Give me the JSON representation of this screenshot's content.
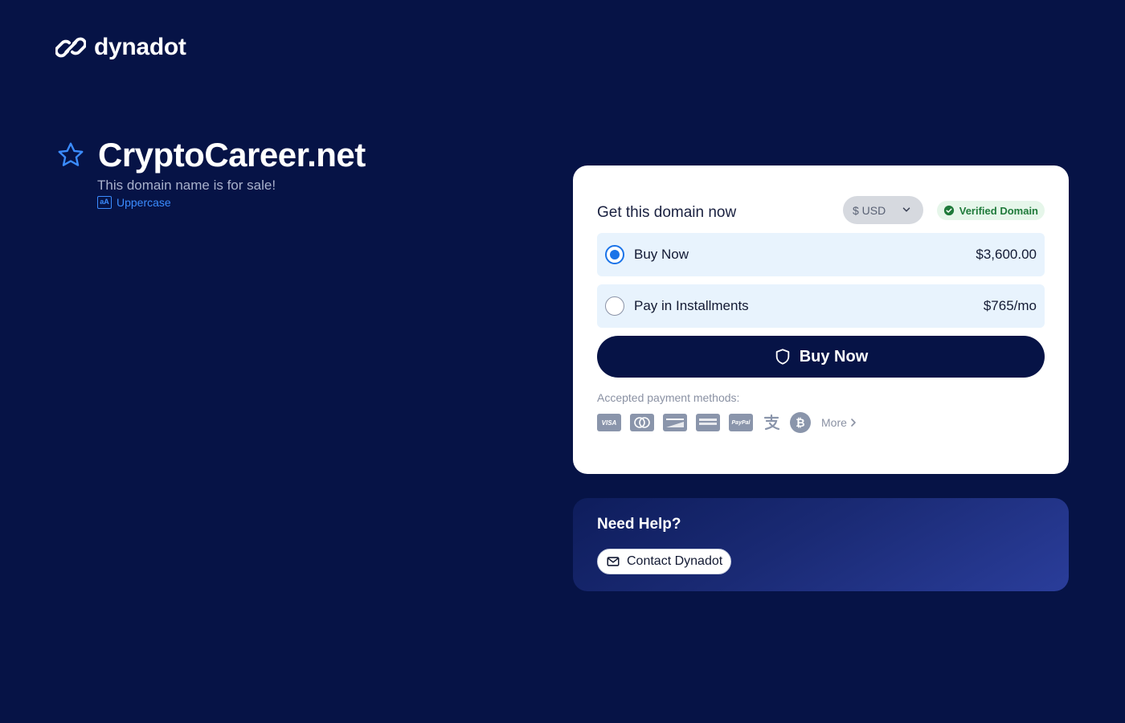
{
  "brand": {
    "name": "dynadot",
    "icon": "link-chain-icon"
  },
  "domain": {
    "name": "CryptoCareer.net",
    "subtitle": "This domain name is for sale!",
    "case_toggle_label": "Uppercase",
    "case_icon_text": "aA"
  },
  "purchase": {
    "title": "Get this domain now",
    "currency": "$ USD",
    "verified_label": "Verified Domain",
    "options": [
      {
        "label": "Buy Now",
        "price": "$3,600.00",
        "selected": true
      },
      {
        "label": "Pay in Installments",
        "price": "$765/mo",
        "selected": false
      }
    ],
    "buy_button_label": "Buy Now",
    "payment_label": "Accepted payment methods:",
    "payment_methods": [
      "VISA",
      "Mastercard",
      "DISCOVER",
      "American Express",
      "PayPal",
      "Alipay",
      "Bitcoin"
    ],
    "more_label": "More"
  },
  "help": {
    "title": "Need Help?",
    "contact_label": "Contact Dynadot"
  },
  "colors": {
    "background": "#061346",
    "accent": "#1a73e8",
    "verified_green": "#1f7a3a",
    "link": "#3b8cff"
  }
}
